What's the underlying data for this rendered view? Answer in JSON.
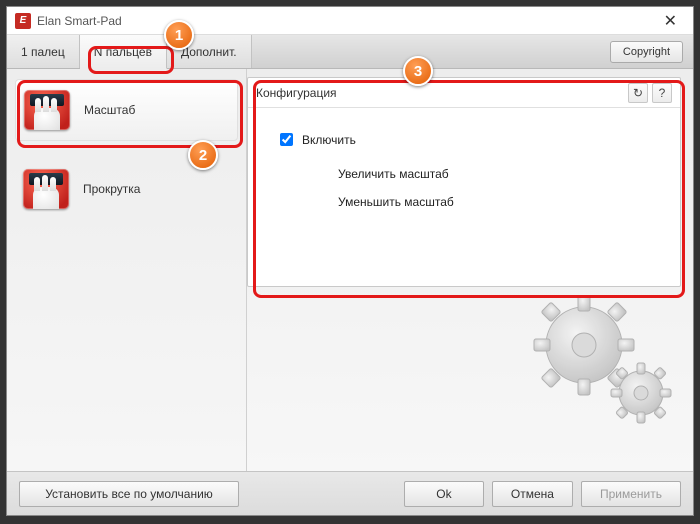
{
  "window": {
    "title": "Elan Smart-Pad",
    "close_glyph": "✕"
  },
  "tabs": [
    {
      "label": "1 палец"
    },
    {
      "label": "N пальцев"
    },
    {
      "label": "Дополнит."
    }
  ],
  "copyright_label": "Copyright",
  "sidebar": {
    "items": [
      {
        "label": "Масштаб"
      },
      {
        "label": "Прокрутка"
      }
    ]
  },
  "config": {
    "title": "Конфигурация",
    "refresh_glyph": "↻",
    "help_glyph": "?",
    "enable_label": "Включить",
    "enable_checked": true,
    "options": [
      "Увеличить масштаб",
      "Уменьшить масштаб"
    ]
  },
  "footer": {
    "defaults": "Установить все по умолчанию",
    "ok": "Ok",
    "cancel": "Отмена",
    "apply": "Применить"
  },
  "annotations": {
    "badge1": "1",
    "badge2": "2",
    "badge3": "3"
  }
}
